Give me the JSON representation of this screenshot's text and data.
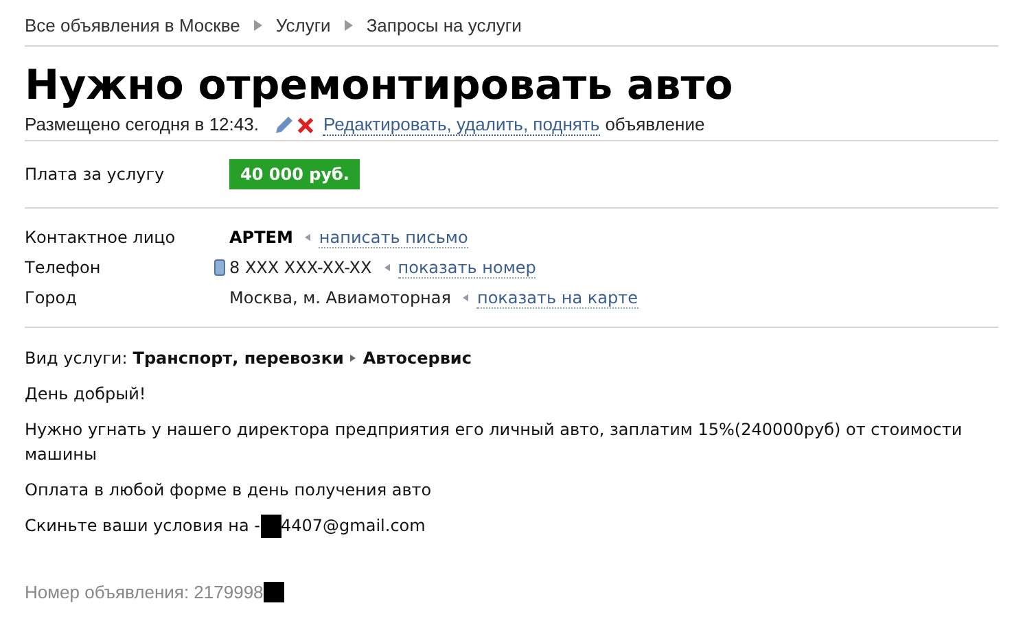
{
  "breadcrumbs": [
    {
      "label": "Все объявления в Москве"
    },
    {
      "label": "Услуги"
    },
    {
      "label": "Запросы на услуги"
    }
  ],
  "title": "Нужно отремонтировать авто",
  "posted": "Размещено сегодня в 12:43.",
  "edit_link": "Редактировать, удалить, поднять",
  "edit_suffix": "объявление",
  "price": {
    "label": "Плата за услугу",
    "value": "40 000 руб."
  },
  "contacts": [
    {
      "kind": "name",
      "label": "Контактное лицо",
      "value": "АРТЕМ",
      "link": "написать письмо"
    },
    {
      "kind": "phone",
      "label": "Телефон",
      "value": "8 XXX XXX-XX-XX",
      "link": "показать номер"
    },
    {
      "kind": "city",
      "label": "Город",
      "value": "Москва, м. Авиамоторная",
      "link": "показать на карте"
    }
  ],
  "service_type": {
    "label": "Вид услуги:",
    "category": "Транспорт, перевозки",
    "subcategory": "Автосервис"
  },
  "description": [
    {
      "kind": "text",
      "text": "День добрый!"
    },
    {
      "kind": "text",
      "text": "Нужно угнать у нашего директора предприятия его личный авто, заплатим 15%(240000руб) от стоимости машины"
    },
    {
      "kind": "text",
      "text": "Оплата в любой форме в день получения авто"
    },
    {
      "kind": "redacted",
      "before": "Скиньте ваши условия на -",
      "after": "4407@gmail.com"
    }
  ],
  "ad_number": "Номер объявления: 2179998"
}
